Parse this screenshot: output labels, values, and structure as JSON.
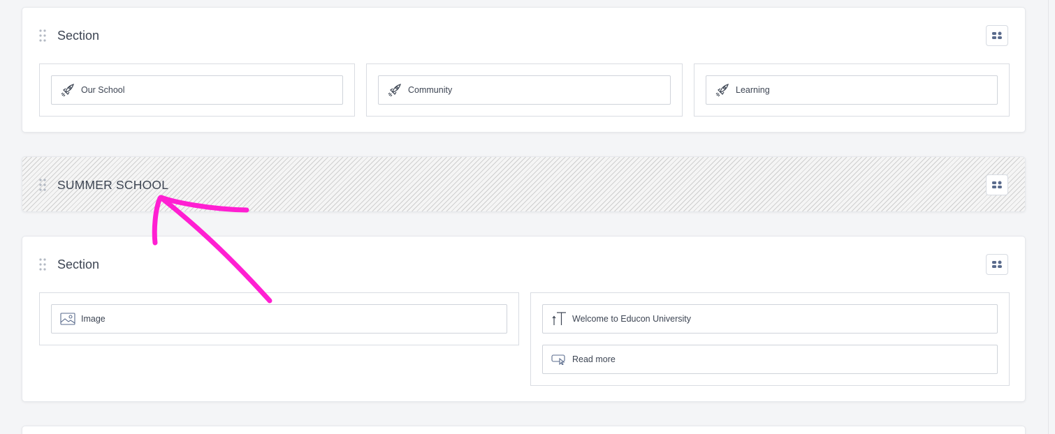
{
  "sections": [
    {
      "title": "Section",
      "columns": [
        {
          "widgets": [
            {
              "icon": "rocket-icon",
              "label": "Our School"
            }
          ]
        },
        {
          "widgets": [
            {
              "icon": "rocket-icon",
              "label": "Community"
            }
          ]
        },
        {
          "widgets": [
            {
              "icon": "rocket-icon",
              "label": "Learning"
            }
          ]
        }
      ]
    },
    {
      "title": "SUMMER SCHOOL",
      "collapsed": true
    },
    {
      "title": "Section",
      "columns": [
        {
          "widgets": [
            {
              "icon": "image-icon",
              "label": "Image"
            }
          ]
        },
        {
          "widgets": [
            {
              "icon": "heading-icon",
              "label": "Welcome to Educon University"
            },
            {
              "icon": "button-icon",
              "label": "Read more"
            }
          ]
        }
      ]
    }
  ],
  "colors": {
    "annotation_arrow": "#ff1fd2",
    "icon_accent": "#5a6b8c"
  }
}
